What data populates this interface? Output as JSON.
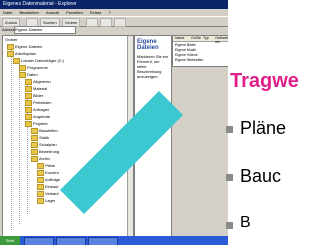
{
  "window": {
    "title": "Eigenes Datenmaterial - Explorer"
  },
  "menu": [
    "Datei",
    "Bearbeiten",
    "Ansicht",
    "Favoriten",
    "Extras",
    "?"
  ],
  "toolbar": [
    "Zurück",
    "",
    "Suchen",
    "Ordner",
    "",
    "",
    ""
  ],
  "address": {
    "label": "Adresse",
    "value": "Eigene Dateien"
  },
  "tree_items": [
    "Ordner",
    "Eigene Dateien",
    "Arbeitsplatz",
    "Lokaler Datenträger (C:)",
    "Programme",
    "Daten",
    "Allgemein",
    "Material",
    "Bilder",
    "Preislisten",
    "Anfragen",
    "Angebote",
    "Projekte",
    "Baustellen",
    "Statik",
    "Schalplan",
    "Bewehrung",
    "Archiv",
    "Pläne",
    "Kunden",
    "Aufträge",
    "Einkauf",
    "Verkauf",
    "Lager"
  ],
  "info_panel": {
    "heading": "Eigene Dateien",
    "text": "Markieren Sie ein Element, um seine Beschreibung anzuzeigen."
  },
  "list_columns": [
    "Name",
    "Größe",
    "Typ",
    "Geändert am"
  ],
  "list_items": [
    "Eigene Bilder",
    "Eigene Musik",
    "Eigene Videos",
    "Eigene Webseiten"
  ],
  "taskbar": {
    "start_label": "Start"
  },
  "overlay": {
    "title": "Tragwe",
    "bullets": [
      "Pläne",
      "Bauc",
      "B"
    ]
  },
  "colors": {
    "accent_title": "#e0208a",
    "cyan_ribbon": "#3cc8d0",
    "taskbar": "#2a5bd4"
  }
}
